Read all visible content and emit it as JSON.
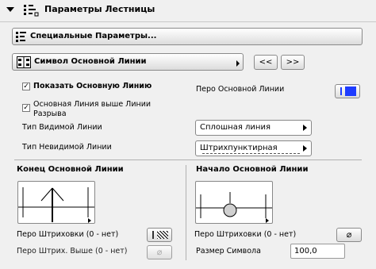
{
  "header": {
    "title": "Параметры Лестницы",
    "icon": "stair-settings-icon"
  },
  "special_params_button": "Специальные Параметры...",
  "symbol_selector": {
    "label": "Символ Основной Линии",
    "prev": "<<",
    "next": ">>"
  },
  "main_line": {
    "show_label": "Показать Основную Линию",
    "show_checked": true,
    "above_break_label_1": "Основная Линия выше Линии",
    "above_break_label_2": "Разрыва",
    "above_break_checked": true,
    "pen_label": "Перо Основной Линии",
    "pen_color": "#1e3cff"
  },
  "visible_line_type": {
    "label": "Тип Видимой Линии",
    "value": "Сплошная линия"
  },
  "hidden_line_type": {
    "label": "Тип Невидимой Линии",
    "value": "Штрихпунктирная"
  },
  "end_section": {
    "title": "Конец Основной Линии",
    "hatch_pen_label": "Перо Штриховки (0 - нет)",
    "hatch_pen_above_label": "Перо Штрих. Выше (0 - нет)",
    "empty_symbol": "⌀"
  },
  "start_section": {
    "title": "Начало Основной Линии",
    "hatch_pen_label": "Перо Штриховки (0 - нет)",
    "size_label": "Размер Символа",
    "size_value": "100,0",
    "empty_symbol": "⌀"
  },
  "colors": {
    "background": "#f0f0f0",
    "pen_blue": "#1e3cff",
    "symbol_gray": "#d0d0d0"
  }
}
